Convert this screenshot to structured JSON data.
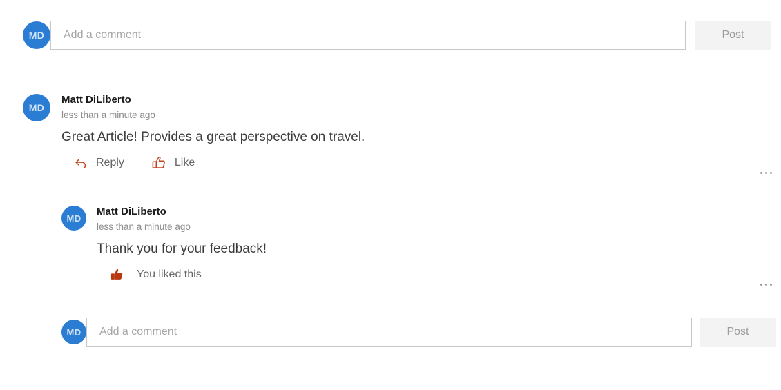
{
  "composer_top": {
    "avatar_initials": "MD",
    "placeholder": "Add a comment",
    "value": "",
    "post_label": "Post"
  },
  "composer_bottom": {
    "avatar_initials": "MD",
    "placeholder": "Add a comment",
    "value": "",
    "post_label": "Post"
  },
  "comments": [
    {
      "avatar_initials": "MD",
      "author": "Matt DiLiberto",
      "timestamp": "less than a minute ago",
      "text": "Great Article! Provides a great perspective on travel.",
      "actions": {
        "reply_label": "Reply",
        "reply_icon": "reply-arrow-icon",
        "like_label": "Like",
        "like_icon": "thumbs-up-outline-icon"
      },
      "more_icon": "ellipsis-icon"
    },
    {
      "avatar_initials": "MD",
      "author": "Matt DiLiberto",
      "timestamp": "less than a minute ago",
      "text": "Thank you for your feedback!",
      "actions": {
        "liked_label": "You liked this",
        "liked_icon": "thumbs-up-filled-icon"
      },
      "more_icon": "ellipsis-icon"
    }
  ],
  "colors": {
    "avatar_blue": "#2b7cd3",
    "action_orange": "#c0451f",
    "liked_orange": "#b8380f",
    "post_bg": "#f3f3f3",
    "post_text": "#9b9b9b",
    "input_border": "#c8c8c8",
    "meta_gray": "#8c8c8c"
  }
}
